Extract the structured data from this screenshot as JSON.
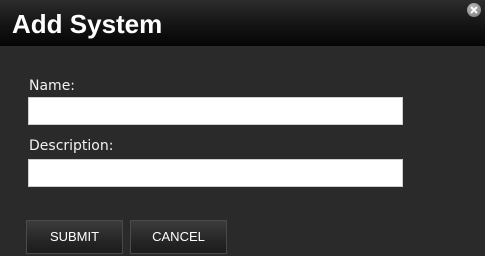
{
  "dialog": {
    "title": "Add System",
    "close_icon": "close-icon"
  },
  "form": {
    "name_label": "Name:",
    "name_value": "",
    "description_label": "Description:",
    "description_value": ""
  },
  "actions": {
    "submit_label": "SUBMIT",
    "cancel_label": "CANCEL"
  },
  "colors": {
    "titlebar": "#141414",
    "body": "#2a2a2a",
    "text": "#ffffff",
    "input_bg": "#ffffff"
  }
}
